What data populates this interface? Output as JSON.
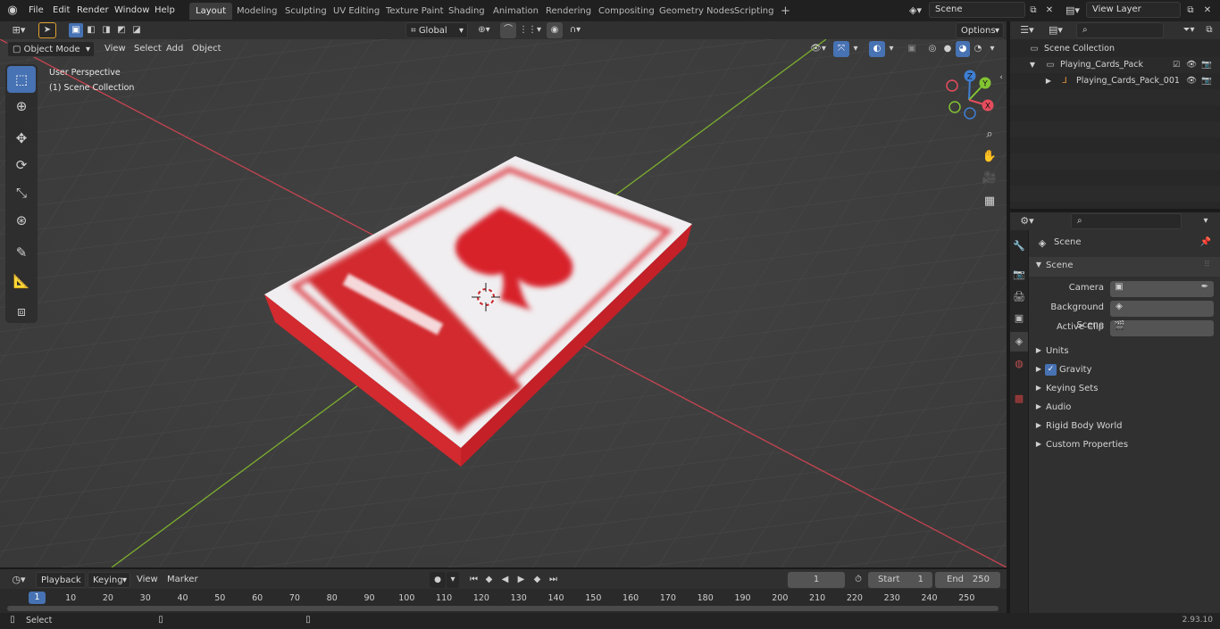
{
  "menu": [
    "File",
    "Edit",
    "Render",
    "Window",
    "Help"
  ],
  "workspaces": [
    "Layout",
    "Modeling",
    "Sculpting",
    "UV Editing",
    "Texture Paint",
    "Shading",
    "Animation",
    "Rendering",
    "Compositing",
    "Geometry Nodes",
    "Scripting"
  ],
  "add_tab": "+",
  "scene_field": "Scene",
  "view_layer_field": "View Layer",
  "toolbar": {
    "transform_orientation": "Global",
    "options": "Options"
  },
  "header": {
    "mode": "Object Mode",
    "items": [
      "View",
      "Select",
      "Add",
      "Object"
    ]
  },
  "viewport": {
    "perspective": "User Perspective",
    "collection": "(1) Scene Collection"
  },
  "axes": {
    "z": "Z",
    "y": "Y",
    "x": "X"
  },
  "outliner": {
    "root": "Scene Collection",
    "collection": "Playing_Cards_Pack",
    "object": "Playing_Cards_Pack_001"
  },
  "properties": {
    "context": "Scene",
    "panel": "Scene",
    "fields": [
      {
        "label": "Camera"
      },
      {
        "label": "Background Scene"
      },
      {
        "label": "Active Clip"
      }
    ],
    "subpanels": [
      "Units",
      "Gravity",
      "Keying Sets",
      "Audio",
      "Rigid Body World",
      "Custom Properties"
    ]
  },
  "timeline": {
    "menus": [
      "Playback",
      "Keying",
      "View",
      "Marker"
    ],
    "current_frame": "1",
    "start_label": "Start",
    "start": "1",
    "end_label": "End",
    "end": "250",
    "ticks": [
      "10",
      "20",
      "30",
      "40",
      "50",
      "60",
      "70",
      "80",
      "90",
      "100",
      "110",
      "120",
      "130",
      "140",
      "150",
      "160",
      "170",
      "180",
      "190",
      "200",
      "210",
      "220",
      "230",
      "240",
      "250"
    ],
    "playhead": "1"
  },
  "status": {
    "select": "Select",
    "version": "2.93.10"
  },
  "icons": [
    "blender-logo-icon",
    "select-box-icon",
    "cursor-icon",
    "move-icon",
    "rotate-icon",
    "scale-icon",
    "transform-icon",
    "annotate-icon",
    "measure-icon",
    "add-cube-icon",
    "zoom-icon",
    "hand-icon",
    "camera-icon",
    "grid-icon",
    "eye-icon",
    "camera-restrict-icon",
    "checkbox-icon",
    "search-icon",
    "filter-icon",
    "pin-icon"
  ],
  "colors": {
    "accent": "#4772b3",
    "axis_x": "#e64d5d",
    "axis_y": "#82c432",
    "axis_z": "#3f7fd4",
    "card_red": "#d8232a"
  }
}
